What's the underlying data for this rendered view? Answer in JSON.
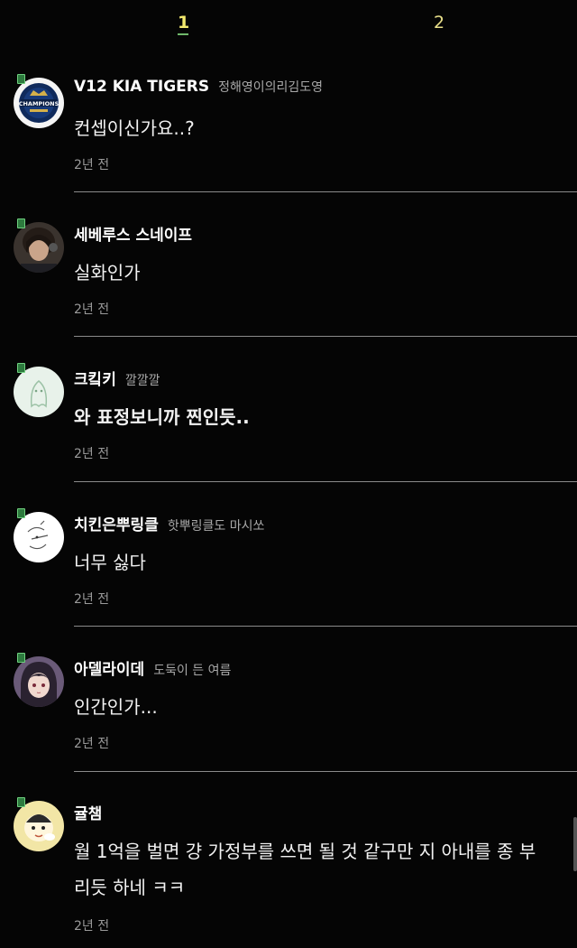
{
  "pagination": {
    "pages": [
      "1",
      "2"
    ],
    "current": "1",
    "accent": "#f3e96e"
  },
  "comments": [
    {
      "username": "V12 KIA TIGERS",
      "nickname": "정해영이의리김도영",
      "text": "컨셉이신가요..?",
      "time": "2년 전",
      "avatar": "champions-badge-avatar"
    },
    {
      "username": "세베루스 스네이프",
      "nickname": "",
      "text": "실화인가",
      "time": "2년 전",
      "avatar": "person-photo-avatar"
    },
    {
      "username": "크킼키",
      "nickname": "깔깔깔",
      "text": "와 표정보니까 찐인듯..",
      "time": "2년 전",
      "avatar": "ghost-sketch-avatar"
    },
    {
      "username": "치킨은뿌링클",
      "nickname": "핫뿌링클도 마시쏘",
      "text": "너무 싫다",
      "time": "2년 전",
      "avatar": "doodle-avatar"
    },
    {
      "username": "아델라이데",
      "nickname": "도둑이 든 여름",
      "text": "인간인가...",
      "time": "2년 전",
      "avatar": "anime-character-avatar"
    },
    {
      "username": "귤챔",
      "nickname": "",
      "text_line1": "월 1억을 벌면 걍 가정부를 쓰면 될 것 같구만 지 아내를 종 부",
      "text_line2": "리듯 하네 ㅋㅋ",
      "time": "2년 전",
      "avatar": "cartoon-character-avatar"
    }
  ]
}
